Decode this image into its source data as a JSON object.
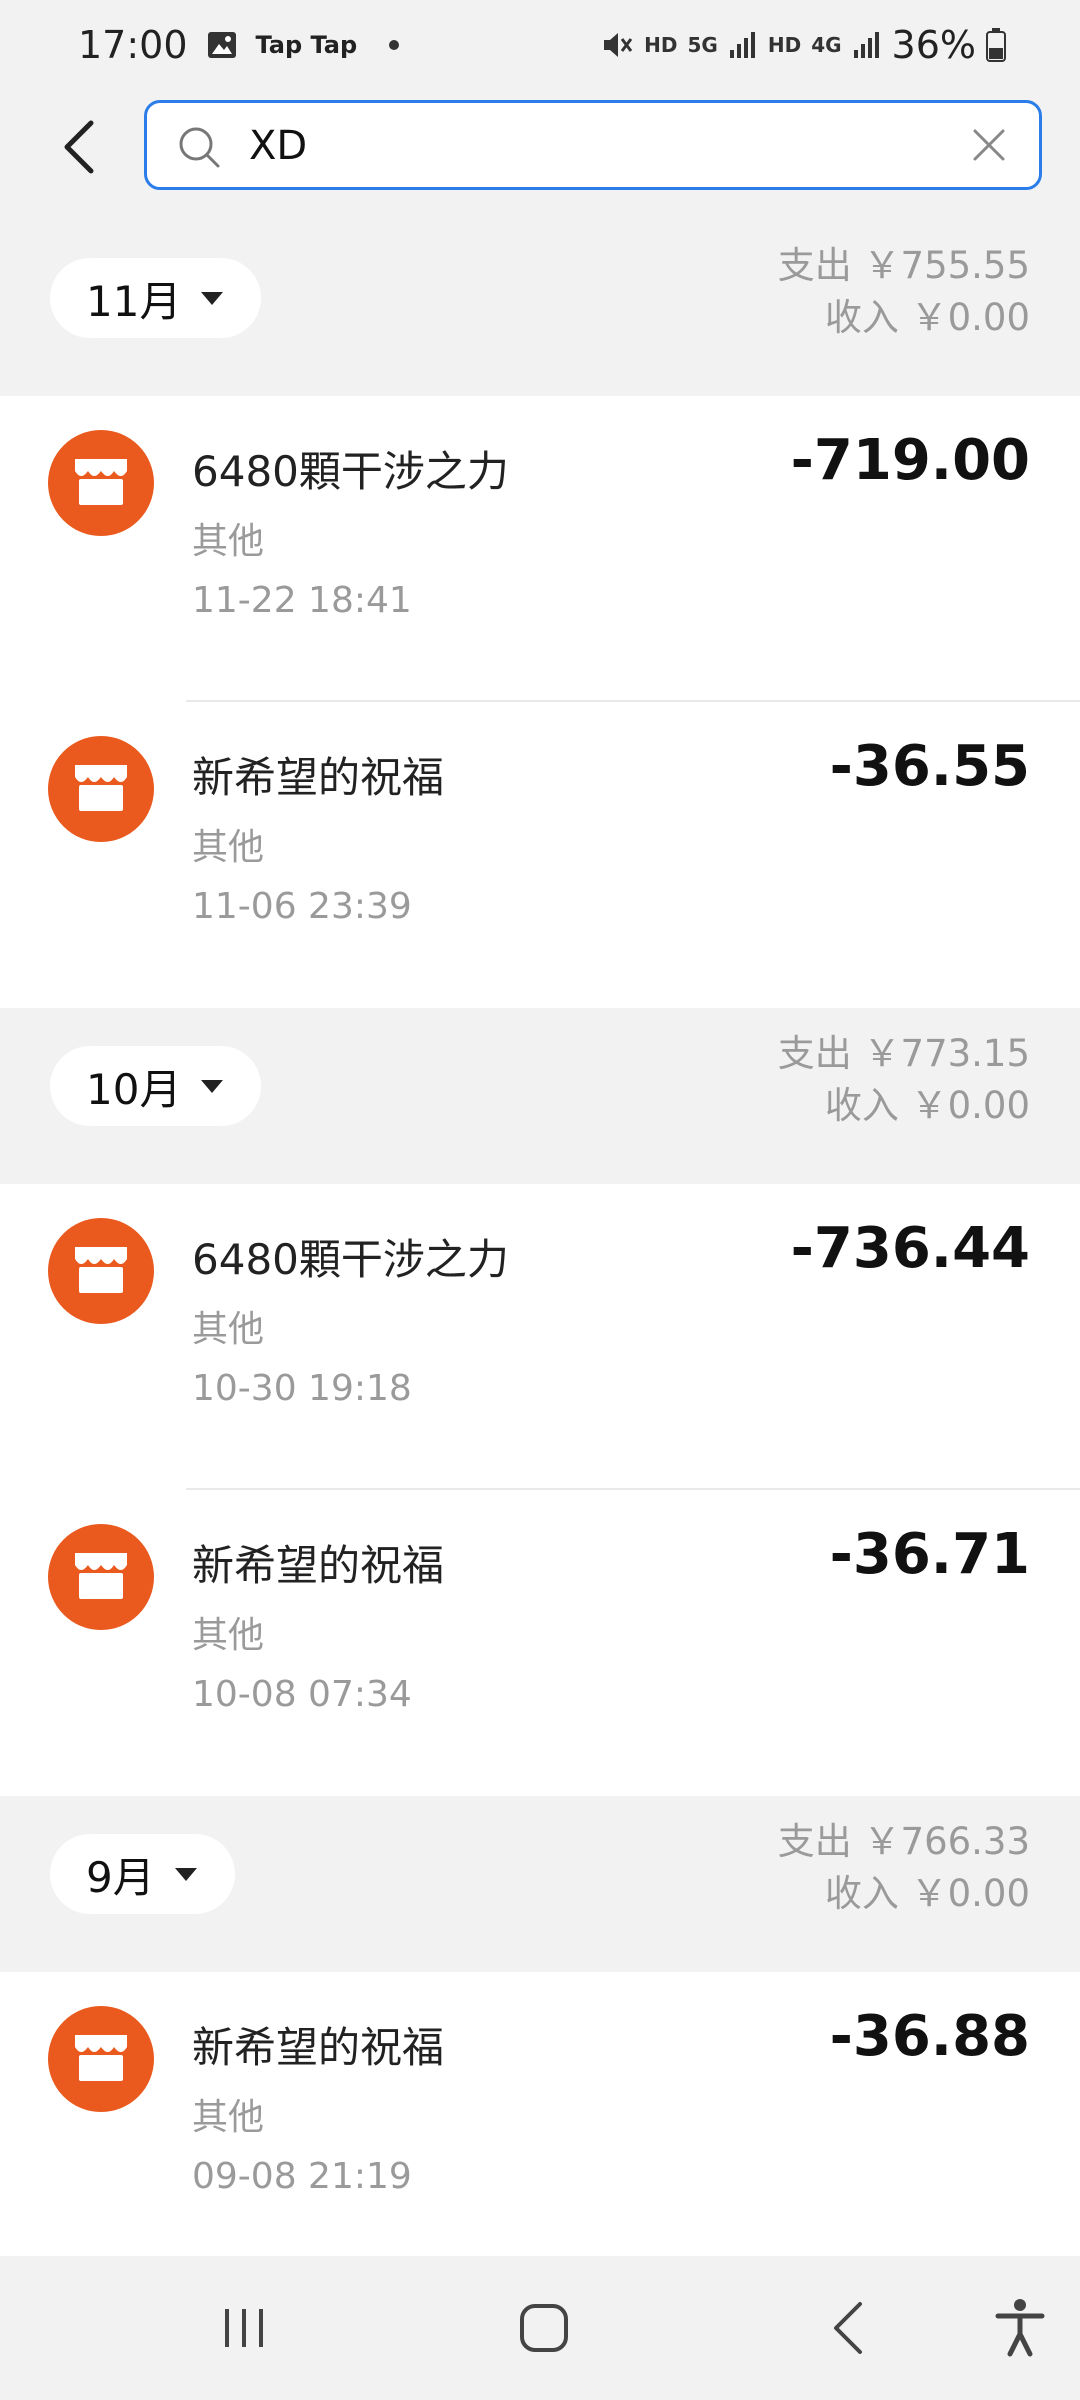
{
  "status_bar": {
    "time": "17:00",
    "app_label": "Tap Tap",
    "hd1": "HD",
    "net1": "5G",
    "hd2": "HD",
    "net2": "4G",
    "battery": "36%"
  },
  "search": {
    "value": "XD",
    "placeholder": ""
  },
  "months": [
    {
      "label": "11月",
      "expense": "支出 ￥755.55",
      "income": "收入 ￥0.00",
      "transactions": [
        {
          "title": "6480顆干涉之力",
          "category": "其他",
          "time": "11-22 18:41",
          "amount": "-719.00"
        },
        {
          "title": "新希望的祝福",
          "category": "其他",
          "time": "11-06 23:39",
          "amount": "-36.55"
        }
      ]
    },
    {
      "label": "10月",
      "expense": "支出 ￥773.15",
      "income": "收入 ￥0.00",
      "transactions": [
        {
          "title": "6480顆干涉之力",
          "category": "其他",
          "time": "10-30 19:18",
          "amount": "-736.44"
        },
        {
          "title": "新希望的祝福",
          "category": "其他",
          "time": "10-08 07:34",
          "amount": "-36.71"
        }
      ]
    },
    {
      "label": "9月",
      "expense": "支出 ￥766.33",
      "income": "收入 ￥0.00",
      "transactions": [
        {
          "title": "新希望的祝福",
          "category": "其他",
          "time": "09-08 21:19",
          "amount": "-36.88"
        }
      ]
    }
  ],
  "colors": {
    "accent": "#2b7de9",
    "merchant_icon": "#ea5a1f",
    "muted_text": "#9a9a9a"
  },
  "icons": {
    "merchant": "store-icon",
    "back": "chevron-left-icon",
    "search": "search-icon",
    "clear": "close-icon"
  }
}
